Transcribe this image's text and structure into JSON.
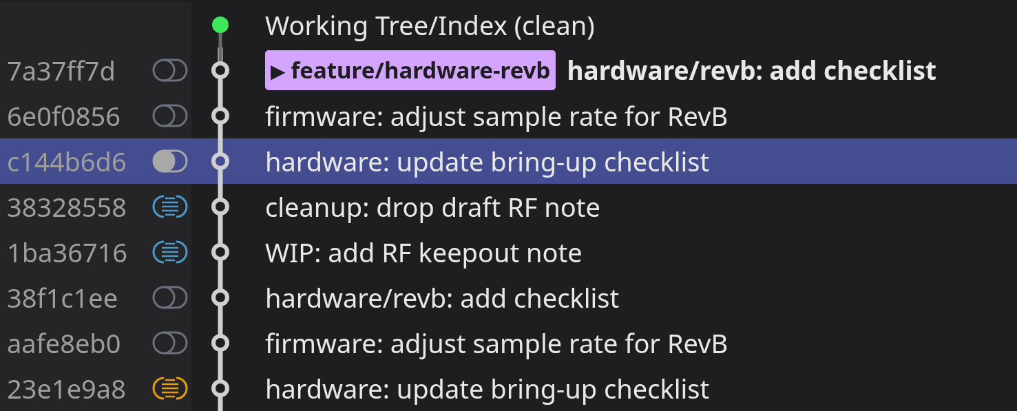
{
  "rows": [
    {
      "kind": "working",
      "message": "Working Tree/Index (clean)",
      "selected": false
    },
    {
      "kind": "commit",
      "hash": "7a37ff7d",
      "color": "#6b717c",
      "branch": {
        "marker": "▶",
        "name": "feature/hardware-revb",
        "color": "#d4a5fc"
      },
      "message": "hardware/revb: add checklist",
      "selected": false
    },
    {
      "kind": "commit",
      "hash": "6e0f0856",
      "color": "#6b717c",
      "message": "firmware: adjust sample rate for RevB",
      "selected": false
    },
    {
      "kind": "commit",
      "hash": "c144b6d6",
      "color": "#a8a8a8",
      "message": "hardware: update bring-up checklist",
      "selected": true
    },
    {
      "kind": "stash",
      "hash": "38328558",
      "color": "#4a9bc9",
      "message": "cleanup: drop draft RF note",
      "selected": false
    },
    {
      "kind": "stash",
      "hash": "1ba36716",
      "color": "#4a9bc9",
      "message": "WIP: add RF keepout note",
      "selected": false
    },
    {
      "kind": "commit",
      "hash": "38f1c1ee",
      "color": "#6b717c",
      "message": "hardware/revb: add checklist",
      "selected": false
    },
    {
      "kind": "commit",
      "hash": "aafe8eb0",
      "color": "#6b717c",
      "message": "firmware: adjust sample rate for RevB",
      "selected": false
    },
    {
      "kind": "stash",
      "hash": "23e1e9a8",
      "color": "#e59e10",
      "message": "hardware: update bring-up checklist",
      "selected": false
    }
  ]
}
